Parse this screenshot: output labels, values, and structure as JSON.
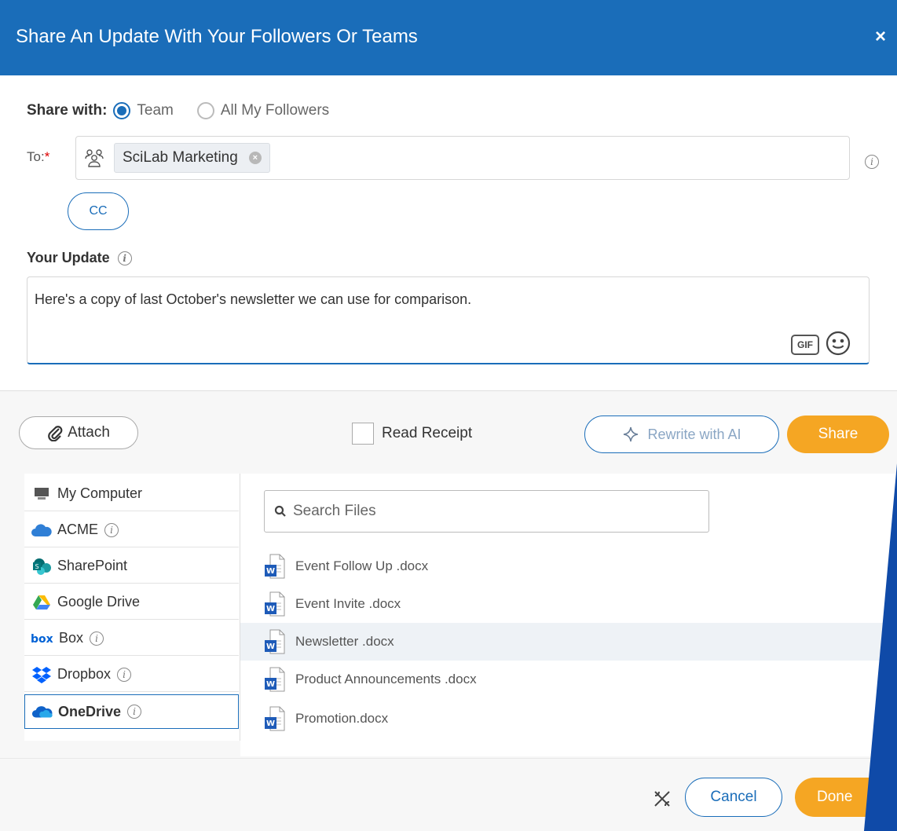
{
  "header": {
    "title": "Share An Update With Your Followers Or Teams",
    "close_symbol": "×"
  },
  "share_with": {
    "label": "Share with:",
    "options": [
      {
        "label": "Team",
        "selected": true
      },
      {
        "label": "All My Followers",
        "selected": false
      }
    ]
  },
  "to": {
    "label": "To:",
    "required_mark": "*",
    "recipient": "SciLab Marketing",
    "remove_symbol": "×"
  },
  "cc": {
    "label": "CC"
  },
  "update": {
    "label": "Your Update",
    "text": "Here's a copy of last October's newsletter we can use for comparison.",
    "gif_label": "GIF"
  },
  "actions": {
    "attach_label": "Attach",
    "read_receipt_label": "Read Receipt",
    "rewrite_label": "Rewrite with AI",
    "share_label": "Share"
  },
  "sources": [
    {
      "label": "My Computer",
      "icon": "computer-icon",
      "info": false,
      "selected": false
    },
    {
      "label": "ACME",
      "icon": "cloud-icon",
      "info": true,
      "selected": false
    },
    {
      "label": "SharePoint",
      "icon": "sharepoint-icon",
      "info": false,
      "selected": false
    },
    {
      "label": "Google Drive",
      "icon": "google-drive-icon",
      "info": false,
      "selected": false
    },
    {
      "label": "Box",
      "icon": "box-icon",
      "info": true,
      "selected": false
    },
    {
      "label": "Dropbox",
      "icon": "dropbox-icon",
      "info": true,
      "selected": false
    },
    {
      "label": "OneDrive",
      "icon": "onedrive-icon",
      "info": true,
      "selected": true
    }
  ],
  "files": {
    "search_placeholder": "Search Files",
    "items": [
      {
        "name": "Event Follow Up .docx",
        "highlighted": false
      },
      {
        "name": "Event Invite .docx",
        "highlighted": false
      },
      {
        "name": "Newsletter .docx",
        "highlighted": true
      },
      {
        "name": "Product Announcements .docx",
        "highlighted": false
      },
      {
        "name": "Promotion.docx",
        "highlighted": false
      }
    ]
  },
  "footer": {
    "cancel_label": "Cancel",
    "done_label": "Done"
  },
  "colors": {
    "primary": "#1a6db9",
    "accent": "#f5a623",
    "slash": "#0f4aa8"
  }
}
